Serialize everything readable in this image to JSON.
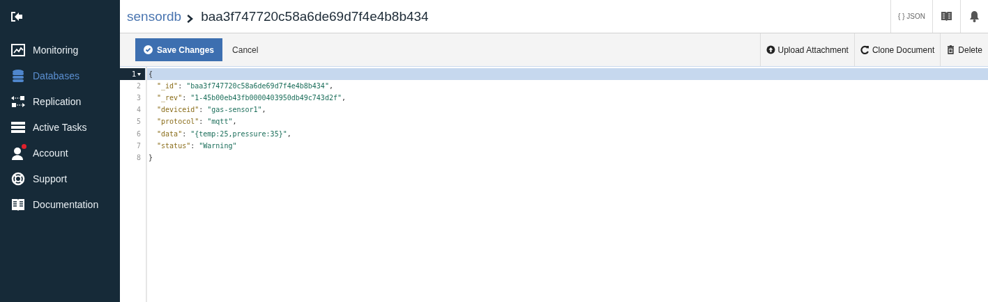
{
  "sidebar": {
    "items": [
      {
        "label": "Monitoring",
        "selected": false,
        "badge": false
      },
      {
        "label": "Databases",
        "selected": true,
        "badge": false
      },
      {
        "label": "Replication",
        "selected": false,
        "badge": false
      },
      {
        "label": "Active Tasks",
        "selected": false,
        "badge": false
      },
      {
        "label": "Account",
        "selected": false,
        "badge": true
      },
      {
        "label": "Support",
        "selected": false,
        "badge": false
      },
      {
        "label": "Documentation",
        "selected": false,
        "badge": false
      }
    ]
  },
  "breadcrumb": {
    "database": "sensordb",
    "document": "baa3f747720c58a6de69d7f4e4b8b434"
  },
  "header_buttons": [
    {
      "kind": "json",
      "label": "{ } JSON"
    },
    {
      "kind": "docs"
    },
    {
      "kind": "bell"
    }
  ],
  "toolbar": {
    "save": "Save Changes",
    "cancel": "Cancel",
    "actions": [
      {
        "kind": "upload",
        "label": "Upload Attachment"
      },
      {
        "kind": "clone",
        "label": "Clone Document"
      },
      {
        "kind": "delete",
        "label": "Delete"
      }
    ]
  },
  "editor": {
    "lines": [
      {
        "number": "1",
        "selected": true,
        "foldable": true,
        "tokens": [
          {
            "kind": "punct",
            "text": "{"
          }
        ]
      },
      {
        "number": "2",
        "selected": false,
        "foldable": false,
        "tokens": [
          {
            "kind": "key",
            "text": "  \"_id\""
          },
          {
            "kind": "punct",
            "text": ": "
          },
          {
            "kind": "string",
            "text": "\"baa3f747720c58a6de69d7f4e4b8b434\""
          },
          {
            "kind": "punct",
            "text": ","
          }
        ]
      },
      {
        "number": "3",
        "selected": false,
        "foldable": false,
        "tokens": [
          {
            "kind": "key",
            "text": "  \"_rev\""
          },
          {
            "kind": "punct",
            "text": ": "
          },
          {
            "kind": "string",
            "text": "\"1-45b00eb43fb0000403950db49c743d2f\""
          },
          {
            "kind": "punct",
            "text": ","
          }
        ]
      },
      {
        "number": "4",
        "selected": false,
        "foldable": false,
        "tokens": [
          {
            "kind": "key",
            "text": "  \"deviceid\""
          },
          {
            "kind": "punct",
            "text": ": "
          },
          {
            "kind": "string",
            "text": "\"gas-sensor1\""
          },
          {
            "kind": "punct",
            "text": ","
          }
        ]
      },
      {
        "number": "5",
        "selected": false,
        "foldable": false,
        "tokens": [
          {
            "kind": "key",
            "text": "  \"protocol\""
          },
          {
            "kind": "punct",
            "text": ": "
          },
          {
            "kind": "string",
            "text": "\"mqtt\""
          },
          {
            "kind": "punct",
            "text": ","
          }
        ]
      },
      {
        "number": "6",
        "selected": false,
        "foldable": false,
        "tokens": [
          {
            "kind": "key",
            "text": "  \"data\""
          },
          {
            "kind": "punct",
            "text": ": "
          },
          {
            "kind": "string",
            "text": "\"{temp:25,pressure:35}\""
          },
          {
            "kind": "punct",
            "text": ","
          }
        ]
      },
      {
        "number": "7",
        "selected": false,
        "foldable": false,
        "tokens": [
          {
            "kind": "key",
            "text": "  \"status\""
          },
          {
            "kind": "punct",
            "text": ": "
          },
          {
            "kind": "string",
            "text": "\"Warning\""
          }
        ]
      },
      {
        "number": "8",
        "selected": false,
        "foldable": false,
        "tokens": [
          {
            "kind": "punct",
            "text": "}"
          }
        ]
      }
    ]
  }
}
